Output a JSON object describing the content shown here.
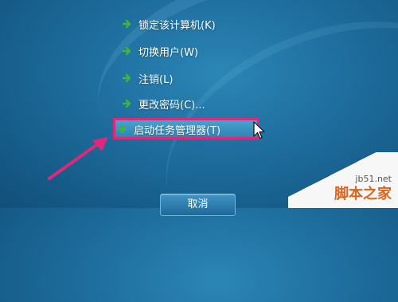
{
  "menu": {
    "items": [
      {
        "label": "锁定该计算机(K)",
        "icon": "green-arrow-icon"
      },
      {
        "label": "切换用户(W)",
        "icon": "green-arrow-icon"
      },
      {
        "label": "注销(L)",
        "icon": "green-arrow-icon"
      },
      {
        "label": "更改密码(C)...",
        "icon": "green-arrow-icon"
      },
      {
        "label": "启动任务管理器(T)",
        "icon": "green-arrow-icon",
        "highlighted": true
      }
    ]
  },
  "cancel_button": {
    "label": "取消"
  },
  "watermark": {
    "site": "jb51.net",
    "name": "脚本之家"
  },
  "colors": {
    "background": "#1d6c9c",
    "highlight_border": "#e0287a",
    "icon_green": "#3cb83c",
    "annotation_arrow": "#e0287a"
  }
}
